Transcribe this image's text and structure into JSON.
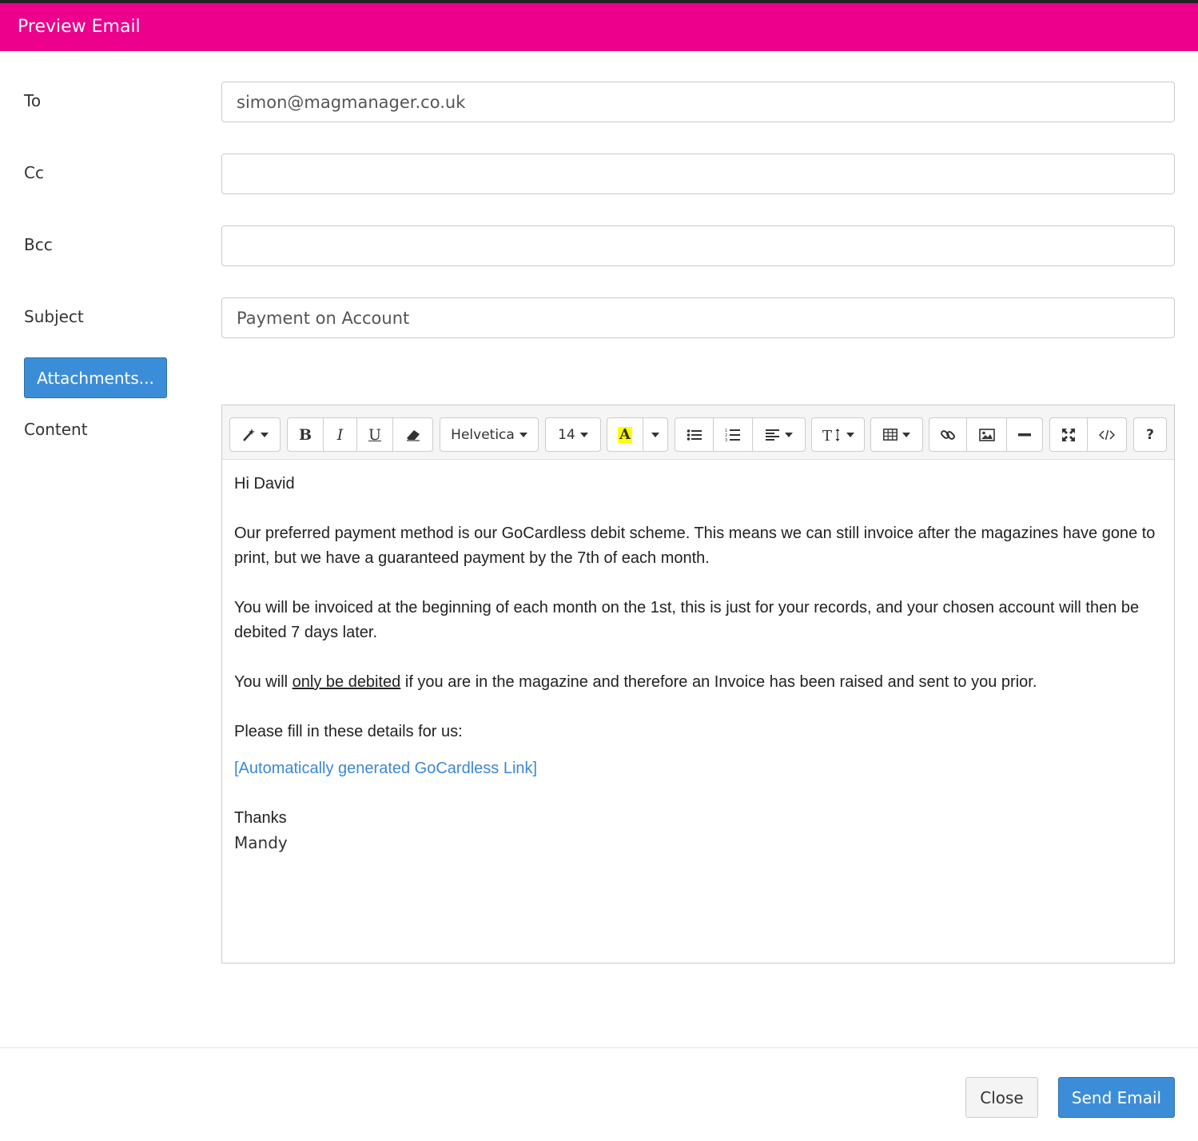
{
  "modal": {
    "title": "Preview Email"
  },
  "form": {
    "to": {
      "label": "To",
      "value": "simon@magmanager.co.uk"
    },
    "cc": {
      "label": "Cc",
      "value": ""
    },
    "bcc": {
      "label": "Bcc",
      "value": ""
    },
    "subject": {
      "label": "Subject",
      "value": "Payment on Account"
    },
    "attachments_label": "Attachments...",
    "content_label": "Content"
  },
  "toolbar": {
    "font_family": "Helvetica",
    "font_size": "14",
    "color_letter": "A",
    "highlight_color": "#ffff00",
    "help": "?",
    "icons": [
      "magic-icon",
      "bold-icon",
      "italic-icon",
      "underline-icon",
      "eraser-icon",
      "font-color-icon",
      "unordered-list-icon",
      "ordered-list-icon",
      "align-left-icon",
      "text-height-icon",
      "table-icon",
      "link-icon",
      "picture-icon",
      "horizontal-rule-icon",
      "fullscreen-icon",
      "code-view-icon",
      "help-icon"
    ]
  },
  "email_body": {
    "greeting": "Hi David",
    "para1": "Our preferred payment method is our GoCardless debit scheme. This means we can still invoice after the magazines have gone to print, but we have a guaranteed payment by the 7th of each month.",
    "para2": "You will be invoiced at the beginning of each month on the 1st, this is just for your records, and your chosen account will then be debited 7 days later.",
    "para3_before": "You will ",
    "para3_underlined": "only be debited",
    "para3_after": " if you are in the magazine and therefore an Invoice has been raised and sent to you prior.",
    "para4": "Please fill in these details for us:",
    "link_text": "[Automatically generated GoCardless Link]",
    "signoff": "Thanks",
    "signature": "Mandy"
  },
  "footer": {
    "close_label": "Close",
    "send_label": "Send Email"
  },
  "colors": {
    "header": "#ec008c",
    "primary_button": "#3c8dd8",
    "link": "#3b87d8"
  }
}
